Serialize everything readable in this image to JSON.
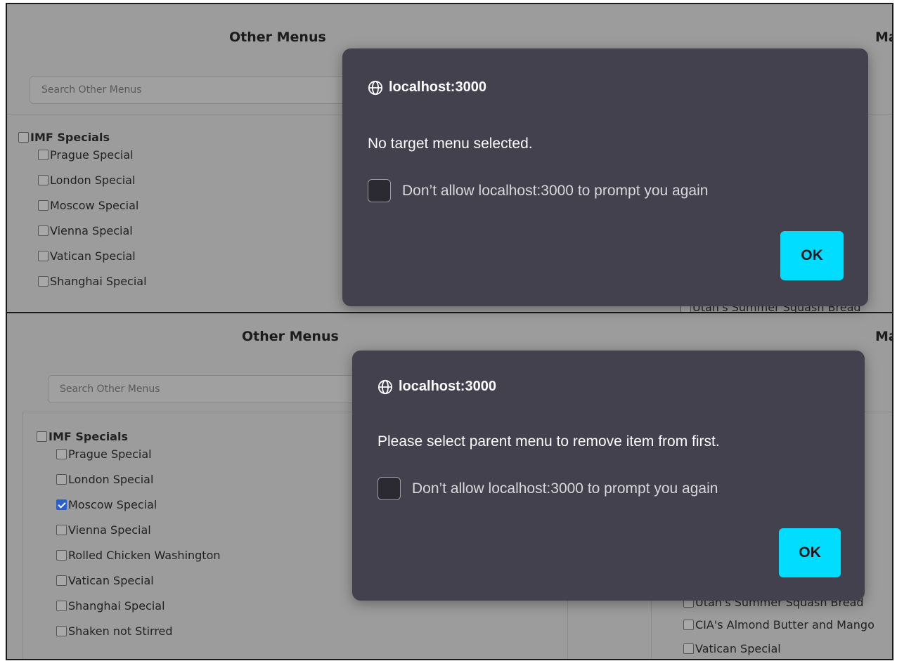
{
  "panels": [
    {
      "left_heading": "Other Menus",
      "right_heading": "Ma",
      "search_placeholder": "Search Other Menus",
      "tree": {
        "parent": "IMF Specials",
        "children": [
          {
            "label": "Prague Special",
            "checked": false
          },
          {
            "label": "London Special",
            "checked": false
          },
          {
            "label": "Moscow Special",
            "checked": false
          },
          {
            "label": "Vienna Special",
            "checked": false
          },
          {
            "label": "Vatican Special",
            "checked": false
          },
          {
            "label": "Shanghai Special",
            "checked": false
          }
        ]
      },
      "right_items": [
        "Utah's Summer Squash Bread"
      ]
    },
    {
      "left_heading": "Other Menus",
      "right_heading": "Ma",
      "search_placeholder": "Search Other Menus",
      "tree": {
        "parent": "IMF Specials",
        "children": [
          {
            "label": "Prague Special",
            "checked": false
          },
          {
            "label": "London Special",
            "checked": false
          },
          {
            "label": "Moscow Special",
            "checked": true
          },
          {
            "label": "Vienna Special",
            "checked": false
          },
          {
            "label": "Rolled Chicken Washington",
            "checked": false
          },
          {
            "label": "Vatican Special",
            "checked": false
          },
          {
            "label": "Shanghai Special",
            "checked": false
          },
          {
            "label": "Shaken not Stirred",
            "checked": false
          }
        ]
      },
      "right_items": [
        "Utah's Summer Squash Bread",
        "CIA's Almond Butter and Mango",
        "Vatican Special"
      ]
    }
  ],
  "dialogs": [
    {
      "origin": "localhost:3000",
      "message": "No target menu selected.",
      "checkbox_label": "Don’t allow localhost:3000 to prompt you again",
      "ok_label": "OK"
    },
    {
      "origin": "localhost:3000",
      "message": "Please select parent menu to remove item from first.",
      "checkbox_label": "Don’t allow localhost:3000 to prompt you again",
      "ok_label": "OK"
    }
  ],
  "colors": {
    "overlay_bg": "#9c9c9c",
    "dialog_bg": "#42414d",
    "ok_button": "#00ddff",
    "checkbox_checked": "#2a5fd0"
  },
  "icons": {
    "dialog_origin": "globe-icon",
    "checked": "checkmark-icon"
  }
}
